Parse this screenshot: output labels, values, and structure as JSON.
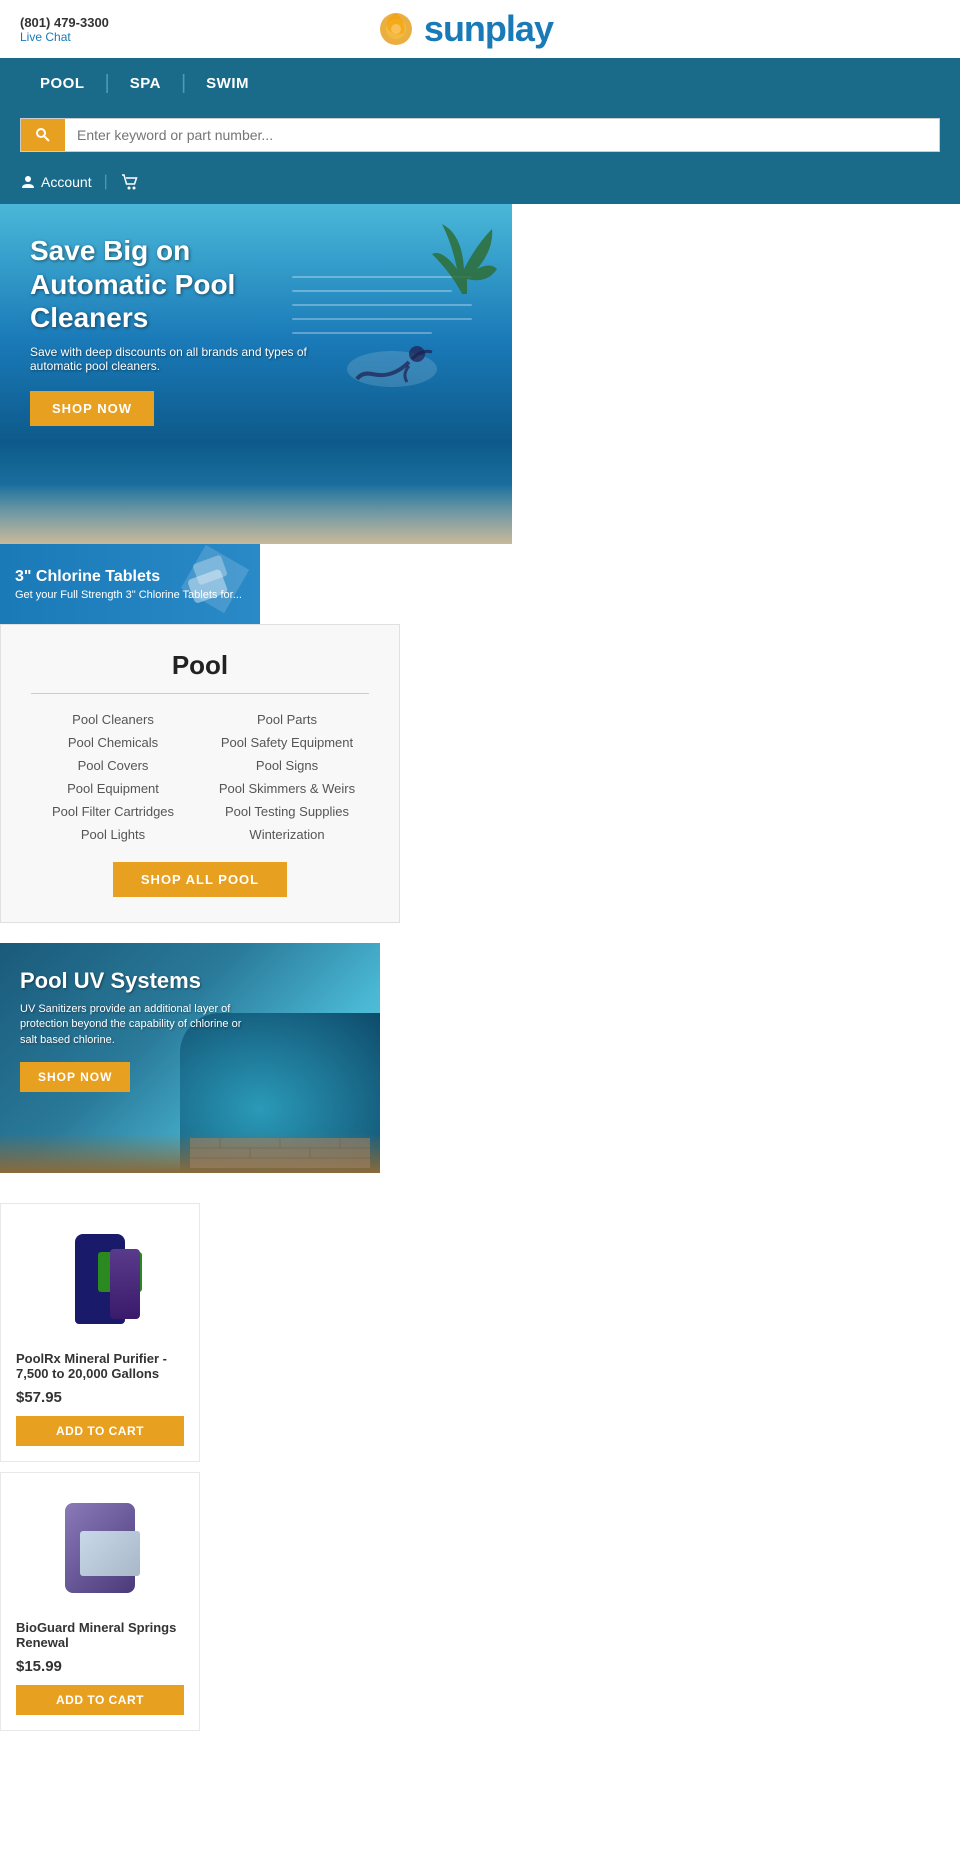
{
  "header": {
    "phone": "(801) 479-3300",
    "live_chat": "Live Chat",
    "logo_text": "sunplay",
    "nav": {
      "pool": "POOL",
      "spa": "SPA",
      "swim": "SWIM"
    },
    "search_placeholder": "Enter keyword or part number...",
    "account_label": "Account"
  },
  "hero": {
    "title": "Save Big on Automatic Pool Cleaners",
    "subtitle": "Save with deep discounts on all brands and types of automatic pool cleaners.",
    "btn_label": "SHOP NOW"
  },
  "chlorine_banner": {
    "title": "3\" Chlorine Tablets",
    "subtitle": "Get your Full Strength 3\" Chlorine Tablets for..."
  },
  "pool_section": {
    "title": "Pool",
    "links": [
      "Pool Cleaners",
      "Pool Parts",
      "Pool Chemicals",
      "Pool Safety Equipment",
      "Pool Covers",
      "Pool Signs",
      "Pool Equipment",
      "Pool Skimmers & Weirs",
      "Pool Filter Cartridges",
      "Pool Testing Supplies",
      "Pool Lights",
      "Winterization"
    ],
    "shop_all_btn": "SHOP ALL POOL"
  },
  "uv_banner": {
    "title": "Pool UV Systems",
    "subtitle": "UV Sanitizers provide an additional layer of protection beyond the capability of chlorine or salt based chlorine.",
    "btn_label": "SHOP NOW"
  },
  "products": [
    {
      "name": "PoolRx Mineral Purifier - 7,500 to 20,000 Gallons",
      "price": "$57.95",
      "add_to_cart": "ADD TO CART",
      "type": "poolrx"
    },
    {
      "name": "BioGuard Mineral Springs Renewal",
      "price": "$15.99",
      "add_to_cart": "ADD TO CART",
      "type": "bioguard"
    }
  ],
  "colors": {
    "nav_bg": "#1a6b8a",
    "btn_orange": "#e8a020",
    "link_blue": "#1a7ab8"
  }
}
